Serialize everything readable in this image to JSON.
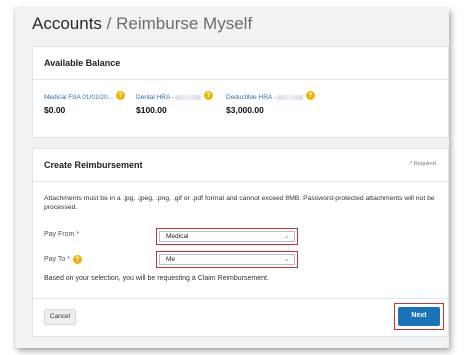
{
  "header": {
    "root": "Accounts",
    "separator": "/",
    "current": "Reimburse Myself"
  },
  "balance": {
    "title": "Available Balance",
    "accounts": [
      {
        "name": "Medical FSA 01/01/20...",
        "amount": "$0.00"
      },
      {
        "name": "Dental HRA - ",
        "amount": "$100.00"
      },
      {
        "name": "Deductible HRA - ",
        "amount": "$3,000.00"
      }
    ]
  },
  "create": {
    "title": "Create Reimbursement",
    "required_note": "* Required",
    "notice": "Attachments must be in a .jpg, .jpeg, .png, .gif or .pdf format and cannot exceed 8MB. Password-protected attachments will not be processed.",
    "pay_from": {
      "label": "Pay From",
      "value": "Medical"
    },
    "pay_to": {
      "label": "Pay To",
      "value": "Me"
    },
    "selection_message": "Based on your selection, you will be requesting a Claim Reimbursement.",
    "cancel_label": "Cancel",
    "next_label": "Next"
  },
  "icons": {
    "help": "question-circle-icon",
    "dropdown": "chevron-down-icon"
  },
  "colors": {
    "link": "#2f6fa7",
    "help": "#f0b400",
    "primary": "#1a73b8",
    "highlight": "#c9323a"
  }
}
